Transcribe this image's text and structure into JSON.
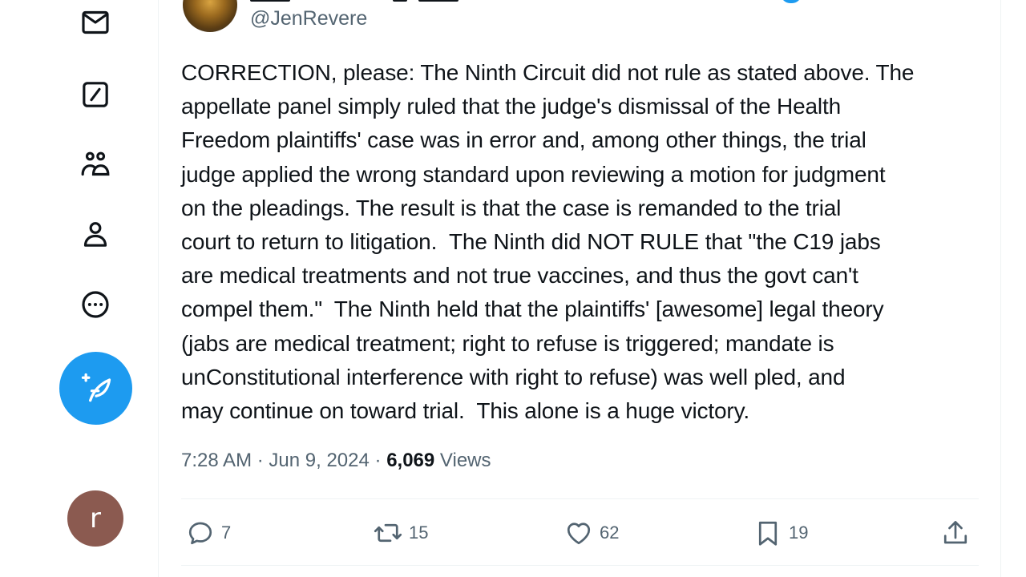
{
  "sidebar": {
    "icons": [
      "messages-icon",
      "grok-icon",
      "communities-icon",
      "profile-icon",
      "more-icon"
    ],
    "compose_icon": "compose-post-icon",
    "user_avatar_letter": "r",
    "user_avatar_color": "#8b5a50"
  },
  "tweet": {
    "handle": "@JenRevere",
    "text": "CORRECTION, please: The Ninth Circuit did not rule as stated above. The\nappellate panel simply ruled that the judge's dismissal of the Health\nFreedom plaintiffs' case was in error and, among other things, the trial\njudge applied the wrong standard upon reviewing a motion for judgment\non the pleadings. The result is that the case is remanded to the trial\ncourt to return to litigation.  The Ninth did NOT RULE that \"the C19 jabs\nare medical treatments and not true vaccines, and thus the govt can't\ncompel them.\"  The Ninth held that the plaintiffs' [awesome] legal theory\n(jabs are medical treatment; right to refuse is triggered; mandate is\nunConstitutional interference with right to refuse) was well pled, and\nmay continue on toward trial.  This alone is a huge victory.",
    "time": "7:28 AM",
    "date": "Jun 9, 2024",
    "separator": "·",
    "views_count": "6,069",
    "views_label": "Views"
  },
  "actions": {
    "replies": "7",
    "reposts": "15",
    "likes": "62",
    "bookmarks": "19"
  },
  "colors": {
    "accent": "#1d9bf0",
    "text_primary": "#0f1419",
    "text_secondary": "#536471",
    "divider": "#eff3f4"
  }
}
